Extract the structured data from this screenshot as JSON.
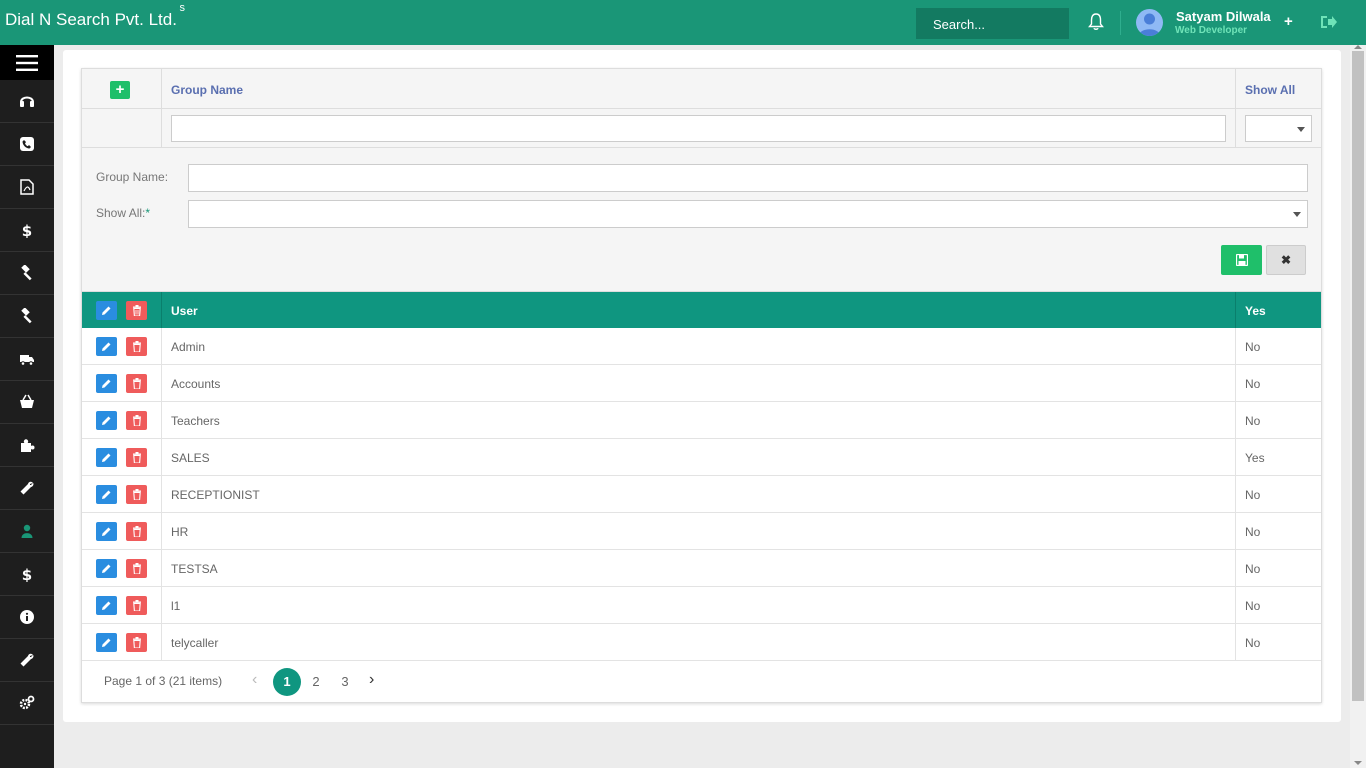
{
  "header": {
    "brand": "Dial N Search Pvt. Ltd.",
    "brand_sup": "s",
    "search_placeholder": "Search...",
    "user_name": "Satyam Dilwala",
    "user_role": "Web Developer",
    "plus_label": "+"
  },
  "sidebar": {
    "items": [
      "headset-icon",
      "phone-icon",
      "pdf-icon",
      "dollar-icon",
      "gavel-icon",
      "gavel-icon",
      "truck-icon",
      "basket-icon",
      "puzzle-icon",
      "wrench-icon",
      "user-icon",
      "dollar-icon",
      "info-icon",
      "wrench-icon",
      "gears-icon"
    ],
    "active_color": "#1a9677"
  },
  "grid": {
    "columns": {
      "group_name": "Group Name",
      "show_all": "Show All"
    },
    "add_label": "+",
    "form": {
      "group_name_label": "Group Name:",
      "show_all_label": "Show All:",
      "required_mark": "*",
      "cancel_label": "✖"
    },
    "table_head": {
      "name": "User",
      "yes": "Yes"
    },
    "rows": [
      {
        "name": "Admin",
        "yes": "No"
      },
      {
        "name": "Accounts",
        "yes": "No"
      },
      {
        "name": "Teachers",
        "yes": "No"
      },
      {
        "name": "SALES",
        "yes": "Yes"
      },
      {
        "name": "RECEPTIONIST",
        "yes": "No"
      },
      {
        "name": "HR",
        "yes": "No"
      },
      {
        "name": "TESTSA",
        "yes": "No"
      },
      {
        "name": "l1",
        "yes": "No"
      },
      {
        "name": "telycaller",
        "yes": "No"
      }
    ],
    "pager": {
      "info": "Page 1 of 3 (21 items)",
      "pages": [
        "1",
        "2",
        "3"
      ],
      "current": "1",
      "prev": "‹",
      "next": "›"
    }
  },
  "colors": {
    "brand": "#1a9677",
    "accent": "#0f9680",
    "add": "#1fbf6a",
    "edit": "#2a8de0",
    "delete": "#ef5b5b"
  }
}
